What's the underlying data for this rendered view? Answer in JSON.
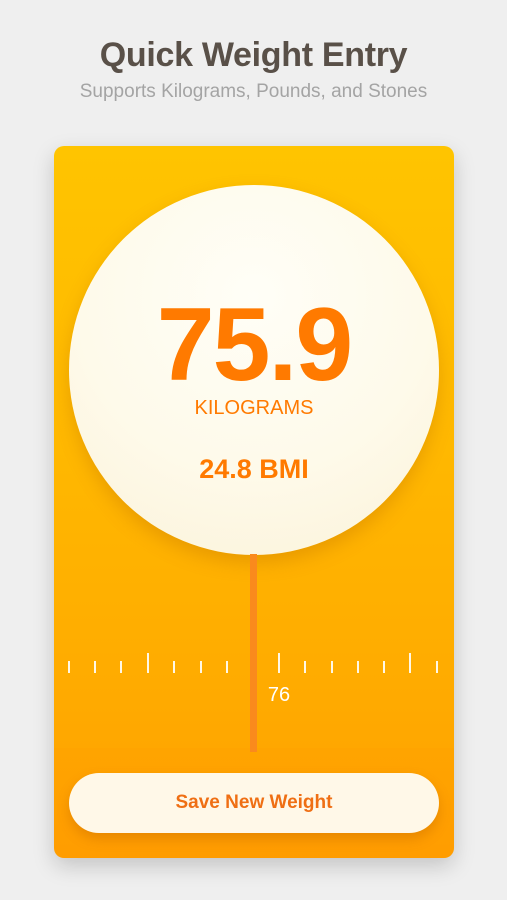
{
  "header": {
    "title": "Quick Weight Entry",
    "subtitle": "Supports Kilograms, Pounds, and Stones"
  },
  "dial": {
    "weight": "75.9",
    "unit": "KILOGRAMS",
    "bmi": "24.8 BMI"
  },
  "ruler": {
    "label": "76",
    "current_value": 75.9
  },
  "actions": {
    "save_label": "Save New Weight"
  },
  "colors": {
    "accent": "#ff7a00",
    "card_top": "#ffc400",
    "card_bottom": "#ffa000",
    "pointer": "#fa8a1d",
    "title": "#595048",
    "subtitle": "#a4a4a4"
  }
}
